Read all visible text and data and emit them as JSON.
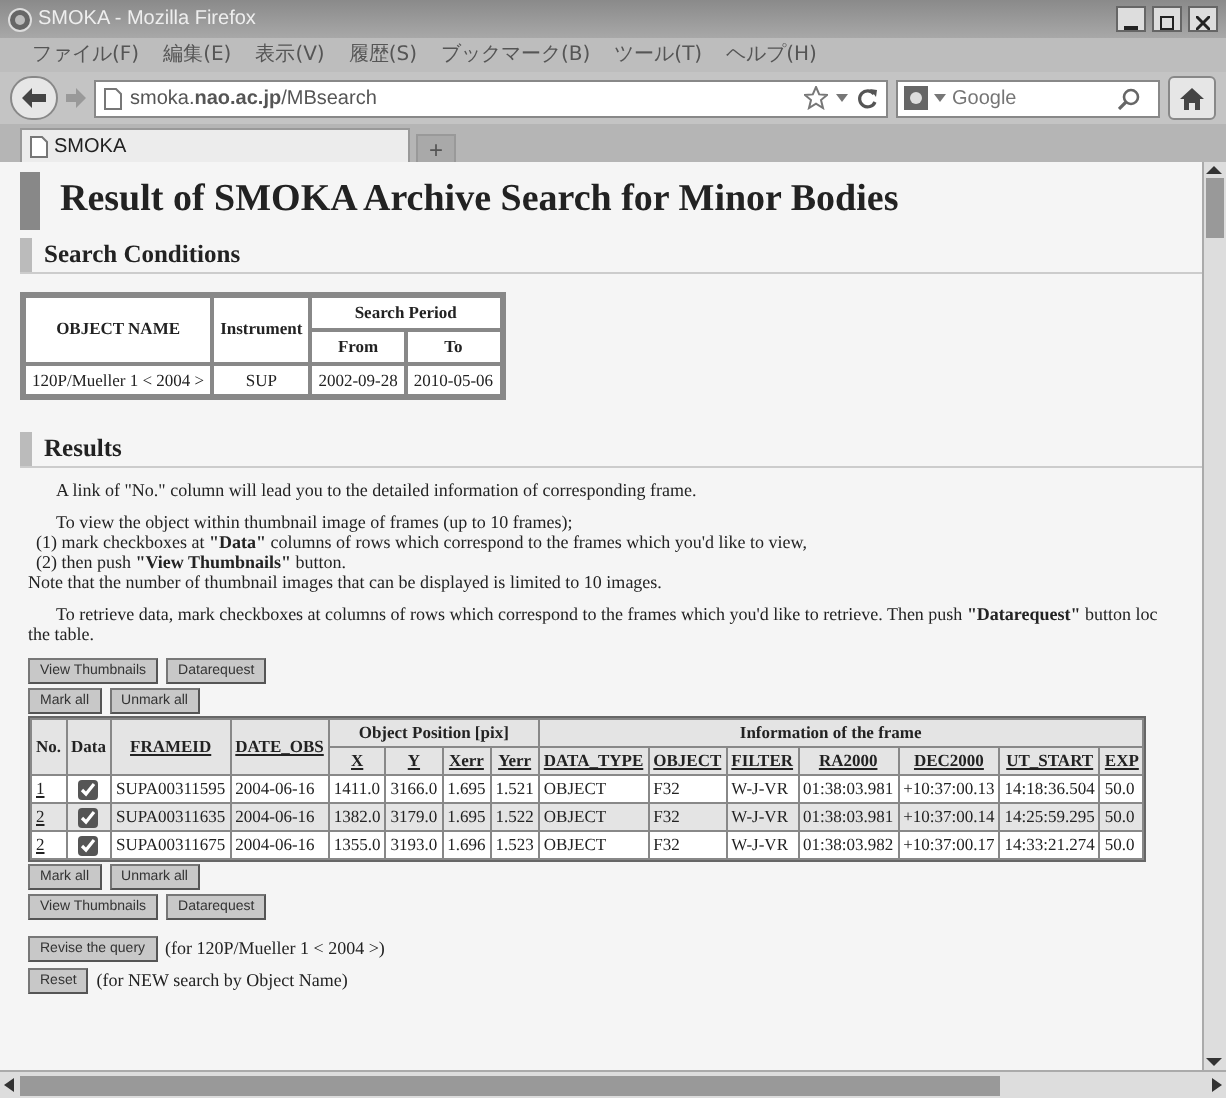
{
  "window": {
    "title": "SMOKA - Mozilla Firefox"
  },
  "menu": [
    "ファイル(F)",
    "編集(E)",
    "表示(V)",
    "履歴(S)",
    "ブックマーク(B)",
    "ツール(T)",
    "ヘルプ(H)"
  ],
  "address": {
    "value": "smoka.**nao.ac.jp**/MBsearch"
  },
  "search": {
    "placeholder": "Google"
  },
  "tabs": [
    {
      "label": "SMOKA",
      "selected": true
    }
  ],
  "new_tab": "+",
  "page": {
    "heading": "Result of SMOKA Archive Search for Minor Bodies",
    "conditions": {
      "heading": "Search Conditions",
      "col_object": "OBJECT NAME",
      "col_instrument": "Instrument",
      "col_period": "Search Period",
      "col_from": "From",
      "col_to": "To",
      "row": [
        "120P/Mueller 1 < 2004 >",
        "SUP",
        "2002-09-28",
        "2010-05-06"
      ]
    },
    "results": {
      "heading": "Results",
      "paragraphs": [
        "A link of \"No.\" column will lead you to the detailed information of corresponding frame.",
        "To view the object within thumbnail image of frames (up to 10 frames);",
        "(1) mark checkboxes at **\"Data\"** columns of rows which correspond to the frames which you'd like to view,",
        "(2) then push **\"View Thumbnails\"** button.",
        "Note that the number of thumbnail images that can be displayed is limited to 10 images.",
        "To retrieve data, mark checkboxes at columns of rows which correspond to the frames which you'd like to retrieve. Then push **\"Datarequest\"** button loc",
        "the table."
      ],
      "top_buttons": [
        [
          "View Thumbnails",
          "Datarequest"
        ],
        [
          "Mark all",
          "Unmark all"
        ]
      ],
      "table": {
        "group_position": "Object Position [pix]",
        "group_info": "Information of the frame",
        "head1": [
          "No.",
          "Data",
          "FRAMEID",
          "DATE_OBS"
        ],
        "head2": [
          "X",
          "Y",
          "Xerr",
          "Yerr",
          "DATA_TYPE",
          "OBJECT",
          "FILTER",
          "RA2000",
          "DEC2000",
          "UT_START",
          "EXP"
        ],
        "rows": [
          {
            "no": "1",
            "checked": true,
            "cells": [
              "SUPA00311595",
              "2004-06-16",
              "1411.0",
              "3166.0",
              "1.695",
              "1.521",
              "OBJECT",
              "F32",
              "W-J-VR",
              "01:38:03.981",
              "+10:37:00.13",
              "14:18:36.504",
              "50.0"
            ]
          },
          {
            "no": "2",
            "checked": true,
            "cells": [
              "SUPA00311635",
              "2004-06-16",
              "1382.0",
              "3179.0",
              "1.695",
              "1.522",
              "OBJECT",
              "F32",
              "W-J-VR",
              "01:38:03.981",
              "+10:37:00.14",
              "14:25:59.295",
              "50.0"
            ]
          },
          {
            "no": "2",
            "checked": true,
            "cells": [
              "SUPA00311675",
              "2004-06-16",
              "1355.0",
              "3193.0",
              "1.696",
              "1.523",
              "OBJECT",
              "F32",
              "W-J-VR",
              "01:38:03.982",
              "+10:37:00.17",
              "14:33:21.274",
              "50.0"
            ]
          }
        ]
      },
      "bottom_buttons": [
        [
          "Mark all",
          "Unmark all"
        ],
        [
          "View Thumbnails",
          "Datarequest"
        ]
      ],
      "revise": {
        "button": "Revise the query",
        "note": "(for 120P/Mueller 1 < 2004 >)"
      },
      "reset": {
        "button": "Reset",
        "note": "(for NEW search by Object Name)"
      }
    }
  }
}
